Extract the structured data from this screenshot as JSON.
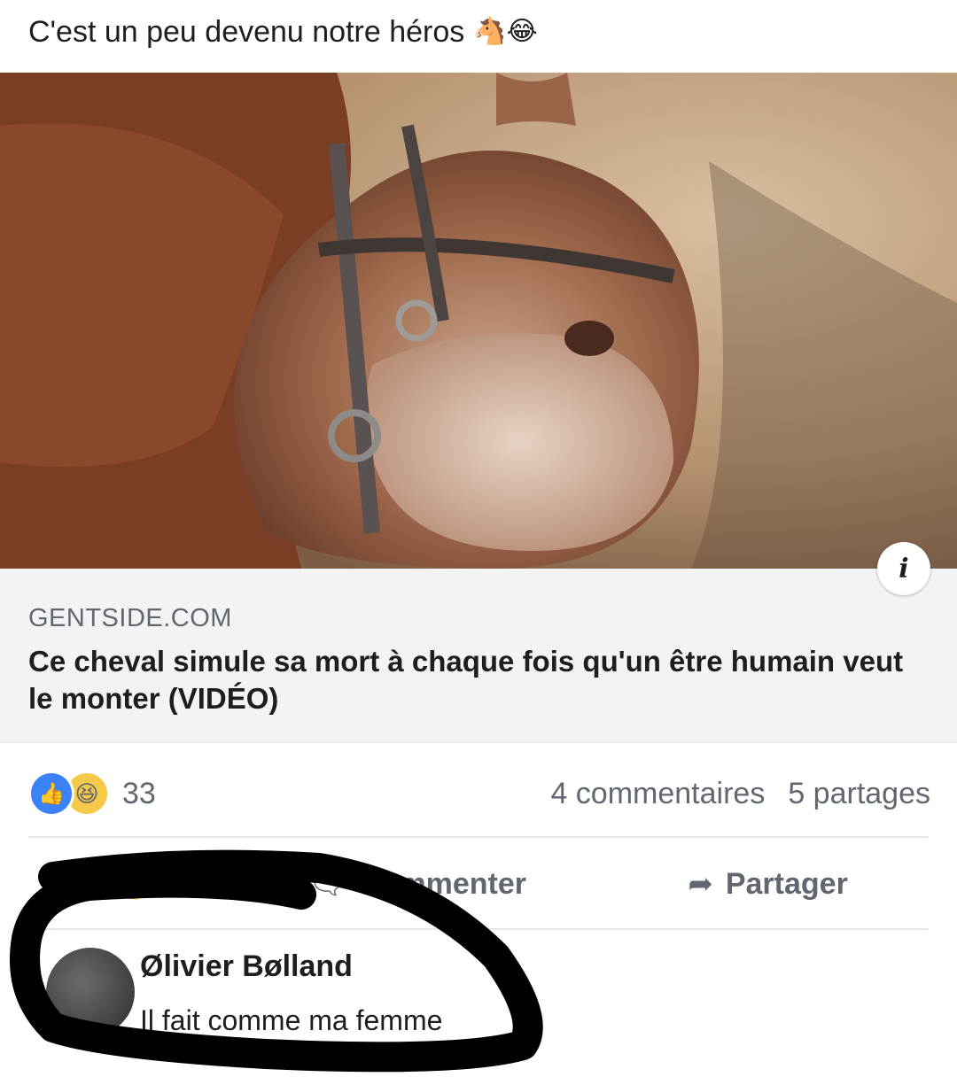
{
  "post": {
    "text": "C'est un peu devenu notre héros",
    "emoji": "🐴😂"
  },
  "link": {
    "info_icon": "i",
    "domain": "GENTSIDE.COM",
    "title": "Ce cheval simule sa mort à chaque fois qu'un être humain veut le monter (VIDÉO)"
  },
  "stats": {
    "like_icon": "thumbs-up-icon",
    "haha_icon": "laughing-face-icon",
    "reaction_count": "33",
    "comments": "4 commentaires",
    "shares": "5 partages"
  },
  "actions": {
    "comment_label": "Commenter",
    "share_label": "Partager"
  },
  "comment": {
    "author": "Ølivier Bølland",
    "text": "Il fait comme ma femme"
  },
  "colors": {
    "like_blue": "#3b82f6",
    "haha_yellow": "#f7c948",
    "card_bg": "#f2f3f5",
    "muted_text": "#606770"
  }
}
